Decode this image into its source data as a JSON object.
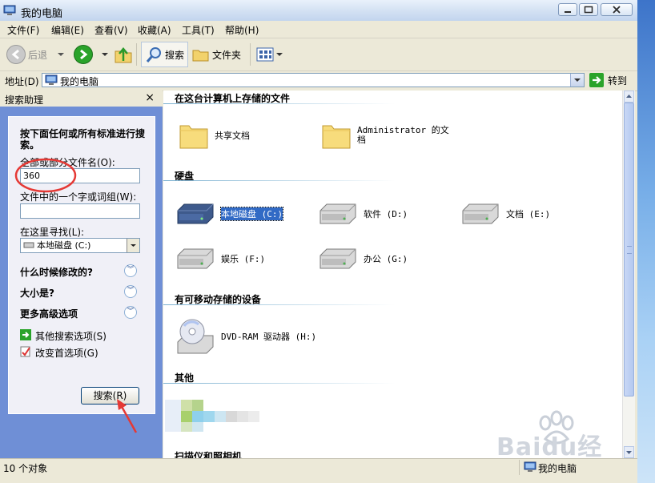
{
  "window": {
    "title": "我的电脑"
  },
  "menu": [
    "文件(F)",
    "编辑(E)",
    "查看(V)",
    "收藏(A)",
    "工具(T)",
    "帮助(H)"
  ],
  "toolbar": {
    "back": "后退",
    "search": "搜索",
    "folders": "文件夹"
  },
  "address": {
    "label": "地址(D)",
    "value": "我的电脑",
    "go": "转到"
  },
  "search_pane": {
    "title": "搜索助理",
    "close": "×",
    "prompt": "按下面任何或所有标准进行搜索。",
    "filename_label": "全部或部分文件名(O):",
    "filename_value": "360",
    "word_label": "文件中的一个字或词组(W):",
    "word_value": "",
    "lookin_label": "在这里寻找(L):",
    "lookin_value": "本地磁盘 (C:)",
    "when": "什么时候修改的?",
    "size": "大小是?",
    "advanced": "更多高级选项",
    "other_options": "其他搜索选项(S)",
    "change_prefs": "改变首选项(G)",
    "search_button": "搜索(R)"
  },
  "groups": {
    "stored": "在这台计算机上存储的文件",
    "disks": "硬盘",
    "removable": "有可移动存储的设备",
    "other": "其他",
    "scanners": "扫描仪和照相机"
  },
  "stored_items": [
    "共享文档",
    "Administrator 的文档"
  ],
  "disk_items": [
    "本地磁盘 (C:)",
    "软件 (D:)",
    "文档 (E:)",
    "娱乐 (F:)",
    "办公 (G:)"
  ],
  "removable_items": [
    "DVD-RAM 驱动器 (H:)"
  ],
  "status": {
    "count": "10 个对象",
    "location": "我的电脑"
  },
  "watermark": "Baidu经验",
  "colors": {
    "annotation": "#e53935",
    "selection": "#316ac5"
  }
}
